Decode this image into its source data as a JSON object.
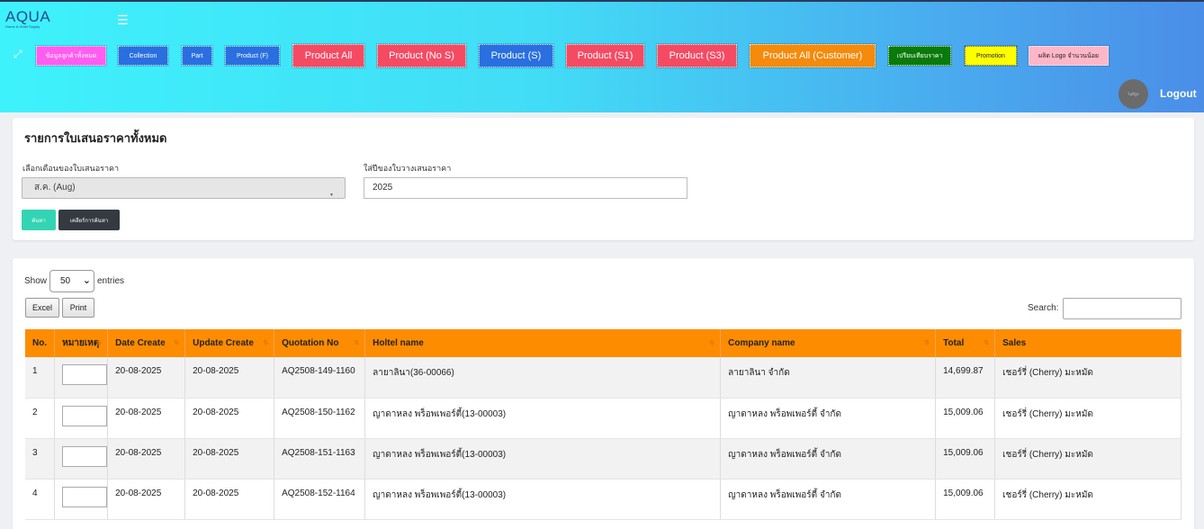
{
  "brand": {
    "logo_text": "AQUA",
    "logo_tagline": "Home & Hotel Supply"
  },
  "header": {
    "menu_icon": "hamburger-icon",
    "fullscreen_icon": "expand-icon",
    "nav": [
      {
        "label": "ข้อมูลลูกค้าทั้งหมด",
        "bg": "#ff5cf0"
      },
      {
        "label": "Collection",
        "bg": "#2a6fe0"
      },
      {
        "label": "Part",
        "bg": "#2a6fe0"
      },
      {
        "label": "Product (F)",
        "bg": "#2a6fe0"
      },
      {
        "label": "Product All",
        "bg": "#f44b63"
      },
      {
        "label": "Product (No S)",
        "bg": "#f44b63"
      },
      {
        "label": "Product (S)",
        "bg": "#2a6fe0"
      },
      {
        "label": "Product (S1)",
        "bg": "#f44b63"
      },
      {
        "label": "Product (S3)",
        "bg": "#f44b63"
      },
      {
        "label": "Product All (Customer)",
        "bg": "#f58a0b"
      },
      {
        "label": "เปรียบเทียบราคา",
        "bg": "#0a7a0a"
      },
      {
        "label": "Promotion",
        "bg": "#ffff00"
      },
      {
        "label": "ผลิต Logo จำนวนน้อย",
        "bg": "#ffb6c8"
      }
    ],
    "avatar_text": "ไม่มีรูป",
    "logout_label": "Logout"
  },
  "filter": {
    "title": "รายการใบเสนอราคาทั้งหมด",
    "month_label": "เลือกเดือนของใบเสนอราคา",
    "month_value": "ส.ค. (Aug)",
    "year_label": "ใส่ปีของใบวางเสนอราคา",
    "year_value": "2025",
    "search_button": "ค้นหา",
    "clear_button": "เคลียร์การค้นหา"
  },
  "table_controls": {
    "show_label": "Show",
    "entries_value": "50",
    "entries_label": "entries",
    "excel_button": "Excel",
    "print_button": "Print",
    "search_label": "Search:"
  },
  "table": {
    "columns": [
      "No.",
      "หมายเหตุ",
      "Date Create",
      "Update Create",
      "Quotation No",
      "Holtel name",
      "Company name",
      "Total",
      "Sales"
    ],
    "rows": [
      {
        "no": "1",
        "date_create": "20-08-2025",
        "update_create": "20-08-2025",
        "quotation_no": "AQ2508-149-1160",
        "hotel": "ลายาลินา(36-00066)",
        "company": "ลายาลินา จำกัด",
        "total": "14,699.87",
        "sales": "เชอร์รี่ (Cherry) มะหมัด"
      },
      {
        "no": "2",
        "date_create": "20-08-2025",
        "update_create": "20-08-2025",
        "quotation_no": "AQ2508-150-1162",
        "hotel": "ญาดาหลง พร็อพเพอร์ตี้(13-00003)",
        "company": "ญาดาหลง พร็อพเพอร์ตี้ จำกัด",
        "total": "15,009.06",
        "sales": "เชอร์รี่ (Cherry) มะหมัด"
      },
      {
        "no": "3",
        "date_create": "20-08-2025",
        "update_create": "20-08-2025",
        "quotation_no": "AQ2508-151-1163",
        "hotel": "ญาดาหลง พร็อพเพอร์ตี้(13-00003)",
        "company": "ญาดาหลง พร็อพเพอร์ตี้ จำกัด",
        "total": "15,009.06",
        "sales": "เชอร์รี่ (Cherry) มะหมัด"
      },
      {
        "no": "4",
        "date_create": "20-08-2025",
        "update_create": "20-08-2025",
        "quotation_no": "AQ2508-152-1164",
        "hotel": "ญาดาหลง พร็อพเพอร์ตี้(13-00003)",
        "company": "ญาดาหลง พร็อพเพอร์ตี้ จำกัด",
        "total": "15,009.06",
        "sales": "เชอร์รี่ (Cherry) มะหมัด"
      }
    ]
  }
}
